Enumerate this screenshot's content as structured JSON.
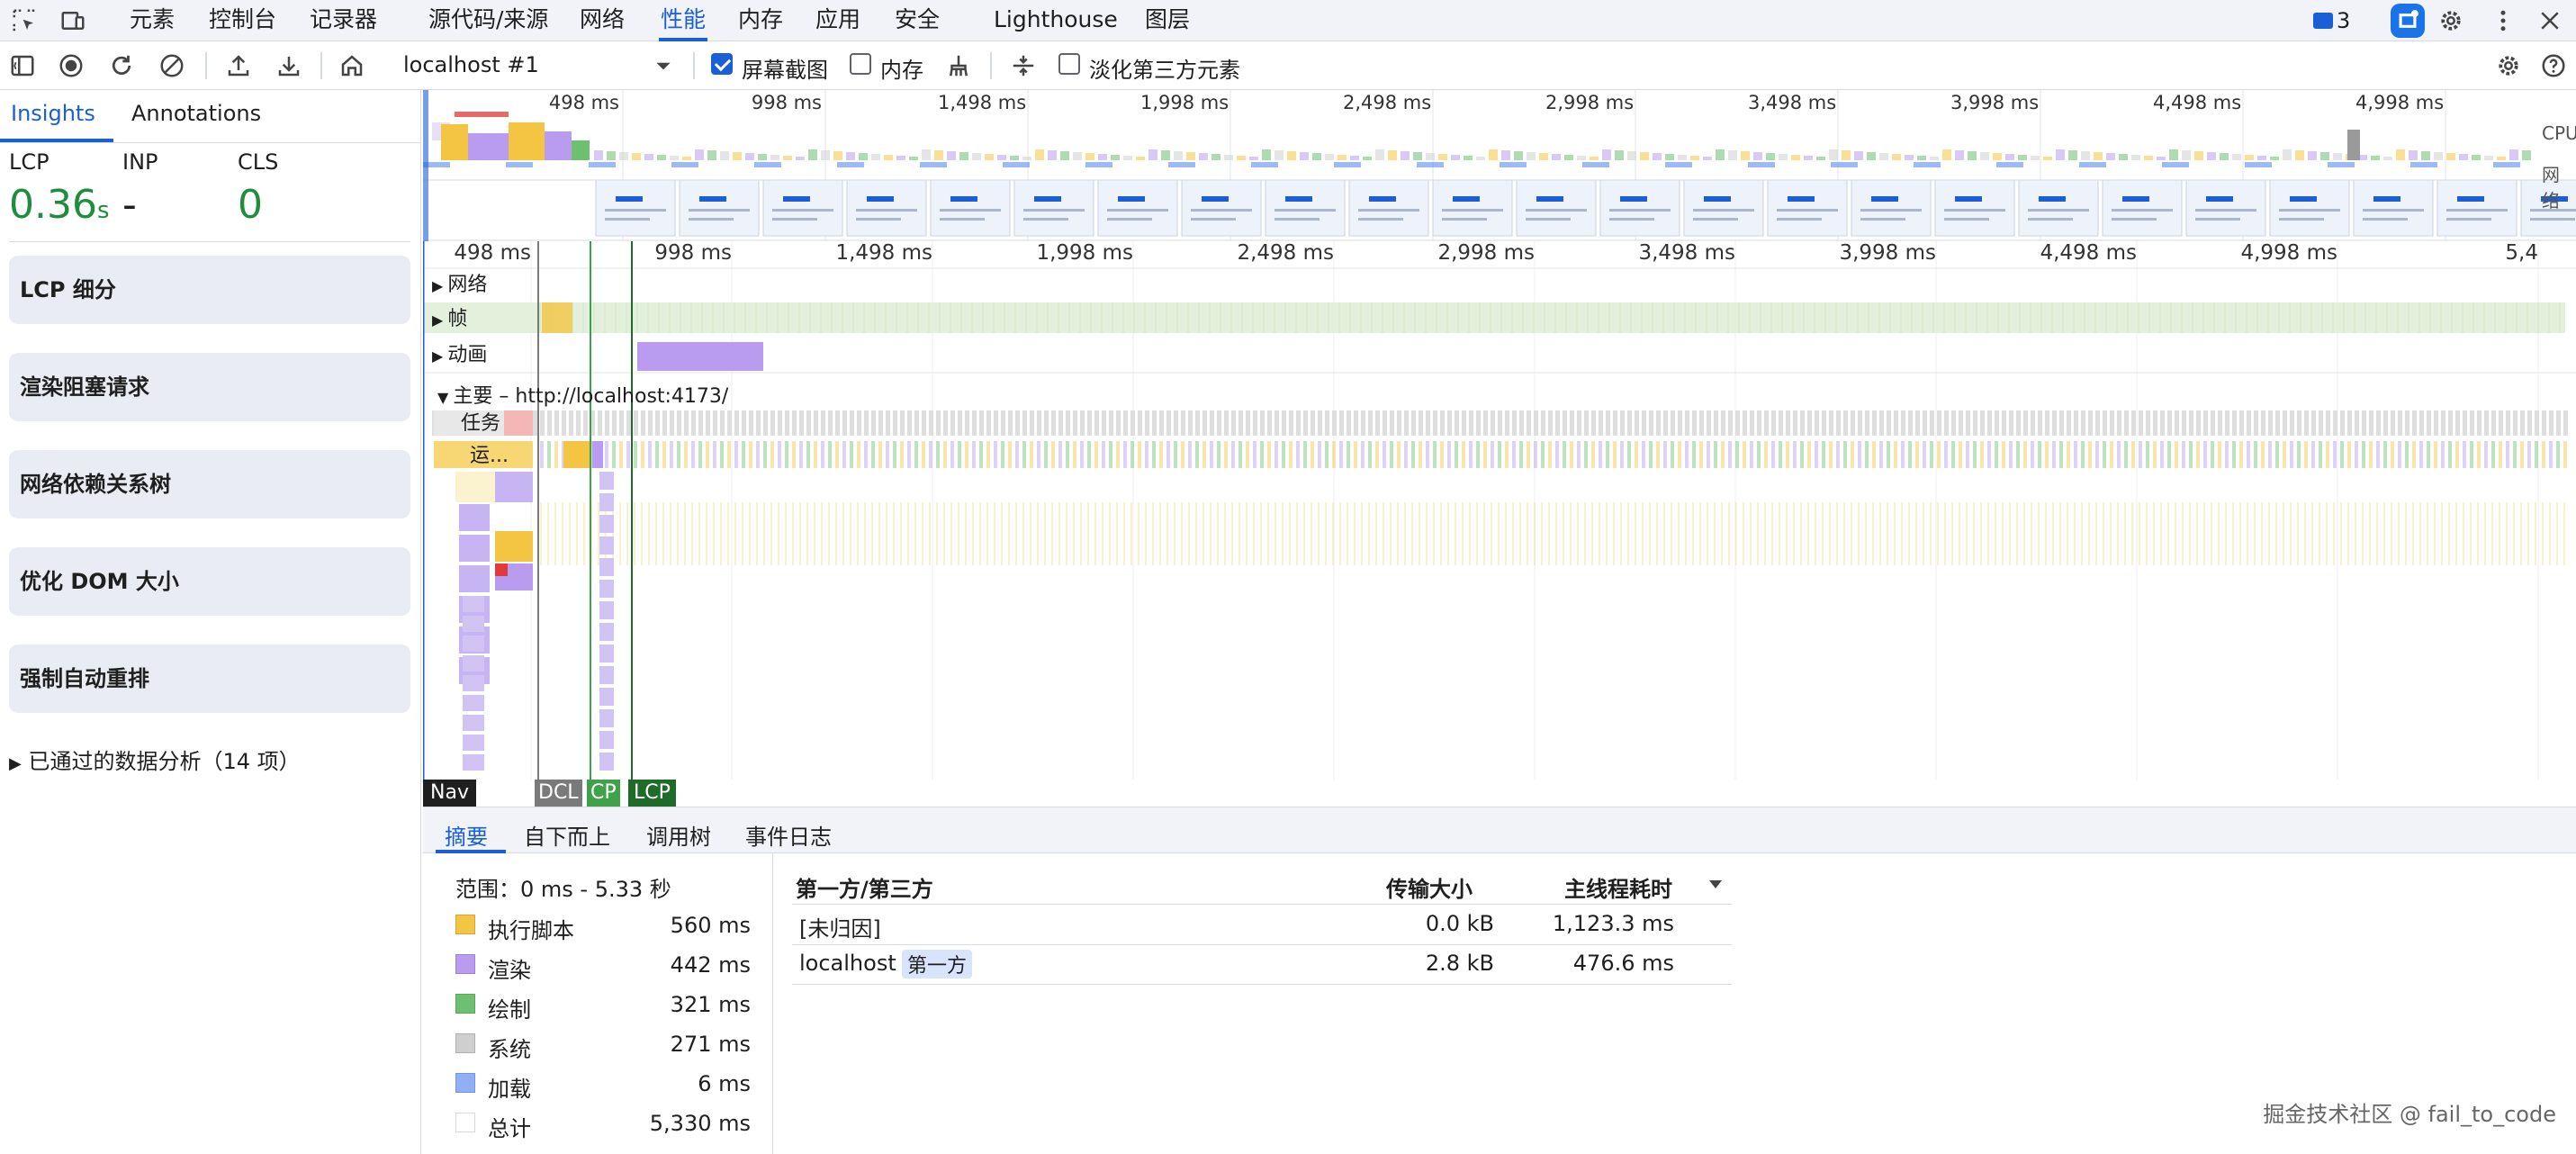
{
  "devtools_tabs": {
    "items": [
      "元素",
      "控制台",
      "记录器",
      "源代码/来源",
      "网络",
      "性能",
      "内存",
      "应用",
      "安全",
      "Lighthouse",
      "图层"
    ],
    "active": "性能",
    "issues_count": "3"
  },
  "toolbar": {
    "target": "localhost #1",
    "screenshot_label": "屏幕截图",
    "screenshot_checked": true,
    "memory_label": "内存",
    "memory_checked": false,
    "dim_third_party_label": "淡化第三方元素",
    "dim_third_party_checked": false
  },
  "sidebar": {
    "tabs": [
      "Insights",
      "Annotations"
    ],
    "active_tab": "Insights",
    "metrics": {
      "lcp_label": "LCP",
      "lcp_value": "0.36",
      "lcp_unit": "s",
      "inp_label": "INP",
      "inp_value": "-",
      "cls_label": "CLS",
      "cls_value": "0"
    },
    "insights": [
      "LCP 细分",
      "渲染阻塞请求",
      "网络依赖关系树",
      "优化 DOM 大小",
      "强制自动重排"
    ],
    "passed": "已通过的数据分析（14 项）"
  },
  "overview": {
    "ticks": [
      "498 ms",
      "998 ms",
      "1,498 ms",
      "1,998 ms",
      "2,498 ms",
      "2,998 ms",
      "3,498 ms",
      "3,998 ms",
      "4,498 ms",
      "4,998 ms"
    ],
    "cpu_label": "CPU",
    "net_label": "网络"
  },
  "timeline": {
    "ticks": [
      "498 ms",
      "998 ms",
      "1,498 ms",
      "1,998 ms",
      "2,498 ms",
      "2,998 ms",
      "3,498 ms",
      "3,998 ms",
      "4,498 ms",
      "4,998 ms",
      "5,4"
    ],
    "tracks": {
      "network": "网络",
      "frames": "帧",
      "animations": "动画",
      "main": "主要 – http://localhost:4173/"
    },
    "task_label": "任务",
    "run_label": "运...",
    "markers": {
      "nav": "Nav",
      "dcl": "DCL",
      "cp": "CP",
      "lcp": "LCP"
    }
  },
  "bottom": {
    "tabs": [
      "摘要",
      "自下而上",
      "调用树",
      "事件日志"
    ],
    "active_tab": "摘要",
    "range": "范围：0 ms - 5.33 秒",
    "categories": [
      {
        "name": "执行脚本",
        "value": "560 ms",
        "color": "#f4c542"
      },
      {
        "name": "渲染",
        "value": "442 ms",
        "color": "#b99cf0"
      },
      {
        "name": "绘制",
        "value": "321 ms",
        "color": "#6cc070"
      },
      {
        "name": "系统",
        "value": "271 ms",
        "color": "#cfcfcf"
      },
      {
        "name": "加载",
        "value": "6 ms",
        "color": "#8fb0f5"
      },
      {
        "name": "总计",
        "value": "5,330 ms",
        "color": "#ffffff"
      }
    ],
    "table": {
      "col_party": "第一方/第三方",
      "col_size": "传输大小",
      "col_time": "主线程耗时",
      "rows": [
        {
          "name": "[未归因]",
          "badge": "",
          "size": "0.0 kB",
          "time": "1,123.3 ms"
        },
        {
          "name": "localhost",
          "badge": "第一方",
          "size": "2.8 kB",
          "time": "476.6 ms"
        }
      ]
    }
  },
  "watermark": "掘金技术社区 @ fail_to_code"
}
